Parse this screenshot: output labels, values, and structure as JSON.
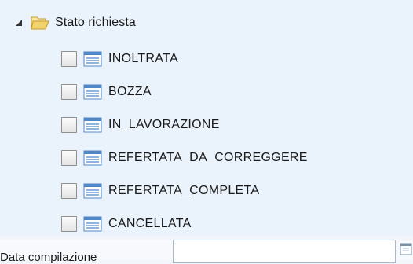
{
  "tree": {
    "root": {
      "label": "Stato richiesta",
      "expanded": true,
      "icon": "folder-icon",
      "expander_icon": "triangle-down-icon"
    },
    "items": [
      {
        "label": "INOLTRATA",
        "checked": false,
        "icon": "document-icon"
      },
      {
        "label": "BOZZA",
        "checked": false,
        "icon": "document-icon"
      },
      {
        "label": "IN_LAVORAZIONE",
        "checked": false,
        "icon": "document-icon"
      },
      {
        "label": "REFERTATA_DA_CORREGGERE",
        "checked": false,
        "icon": "document-icon"
      },
      {
        "label": "REFERTATA_COMPLETA",
        "checked": false,
        "icon": "document-icon"
      },
      {
        "label": "CANCELLATA",
        "checked": false,
        "icon": "document-icon"
      }
    ]
  },
  "form": {
    "date_label": "Data compilazione",
    "date_value": "",
    "calendar_icon": "calendar-icon"
  },
  "colors": {
    "background": "#eaf2fb",
    "doc_icon_blue": "#4f86c6",
    "folder_yellow": "#f3d36b"
  }
}
